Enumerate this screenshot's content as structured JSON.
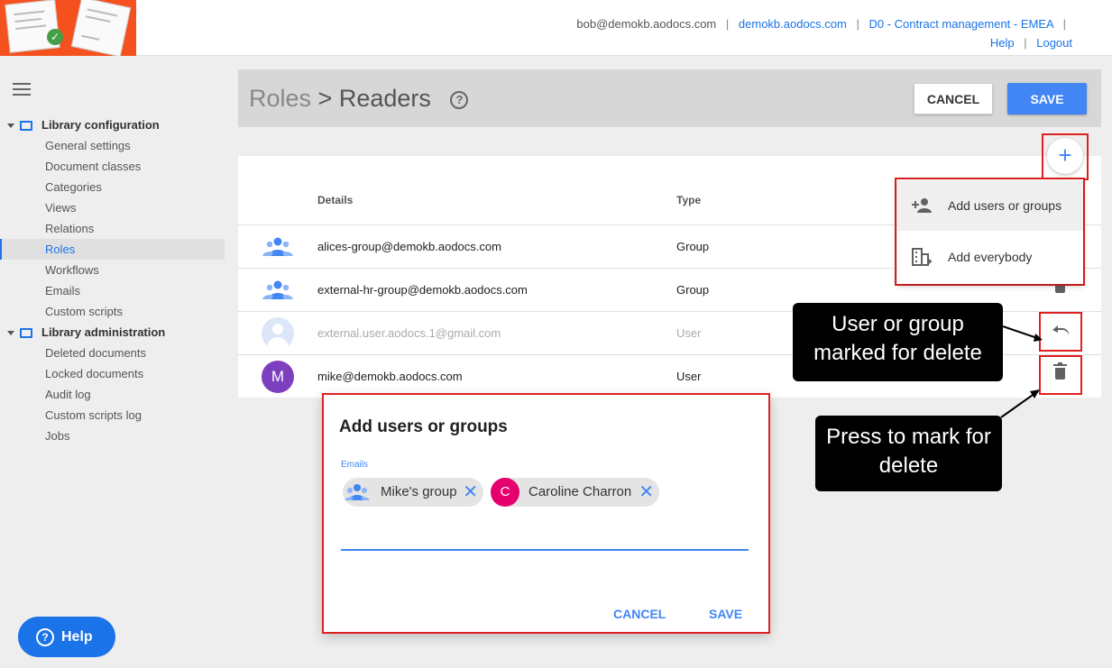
{
  "topbar": {
    "user_email": "bob@demokb.aodocs.com",
    "domain": "demokb.aodocs.com",
    "library": "D0 - Contract management - EMEA",
    "help": "Help",
    "logout": "Logout",
    "separator": "|"
  },
  "sidebar": {
    "config_title": "Library configuration",
    "config_items": [
      "General settings",
      "Document classes",
      "Categories",
      "Views",
      "Relations",
      "Roles",
      "Workflows",
      "Emails",
      "Custom scripts"
    ],
    "admin_title": "Library administration",
    "admin_items": [
      "Deleted documents",
      "Locked documents",
      "Audit log",
      "Custom scripts log",
      "Jobs"
    ],
    "active_item": "Roles"
  },
  "header": {
    "breadcrumb_parent": "Roles",
    "breadcrumb_sep": ">",
    "breadcrumb_current": "Readers",
    "help_glyph": "?",
    "cancel": "CANCEL",
    "save": "SAVE"
  },
  "table": {
    "col_details": "Details",
    "col_type": "Type",
    "rows": [
      {
        "details": "alices-group@demokb.aodocs.com",
        "type": "Group"
      },
      {
        "details": "external-hr-group@demokb.aodocs.com",
        "type": "Group"
      },
      {
        "details": "external.user.aodocs.1@gmail.com",
        "type": "User"
      },
      {
        "details": "mike@demokb.aodocs.com",
        "type": "User",
        "avatar_letter": "M"
      }
    ]
  },
  "add_menu": {
    "fab_glyph": "+",
    "add_users": "Add users or groups",
    "add_everybody": "Add everybody"
  },
  "callouts": {
    "marked": "User or group marked for delete",
    "press": "Press to mark for delete"
  },
  "dialog": {
    "title": "Add users or groups",
    "field_label": "Emails",
    "chips": [
      {
        "label": "Mike's group",
        "kind": "group"
      },
      {
        "label": "Caroline Charron",
        "kind": "user",
        "letter": "C"
      }
    ],
    "remove_glyph": "✕",
    "cancel": "CANCEL",
    "save": "SAVE"
  },
  "help_button": {
    "label": "Help",
    "glyph": "?"
  },
  "colors": {
    "accent": "#4285f4",
    "logo_bg": "#f4511e",
    "annotation_red": "#e02020",
    "avatar_m": "#7e3fbf",
    "avatar_c": "#e6006e"
  }
}
